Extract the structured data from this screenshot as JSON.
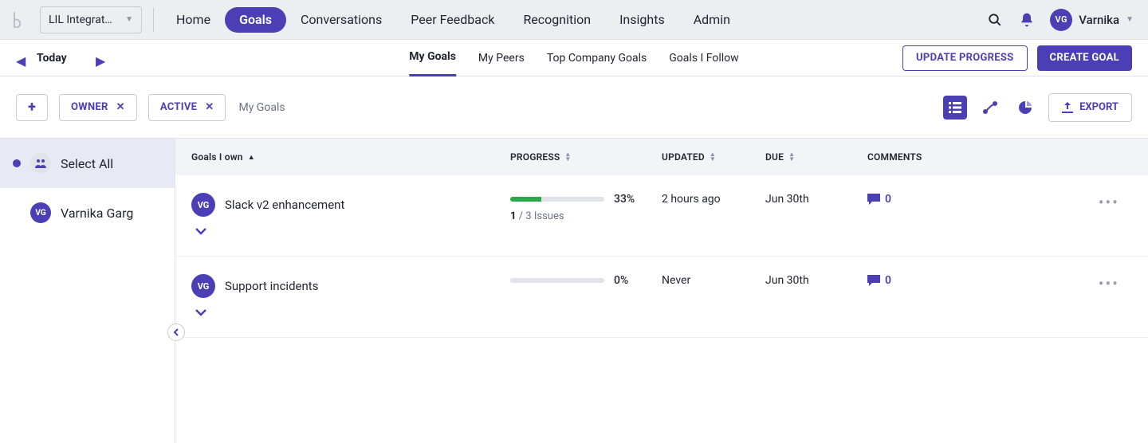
{
  "accent": "#4c3fb5",
  "header": {
    "team_selector": "LIL Integrat…",
    "nav": [
      "Home",
      "Goals",
      "Conversations",
      "Peer Feedback",
      "Recognition",
      "Insights",
      "Admin"
    ],
    "active_nav_index": 1,
    "user": {
      "initials": "VG",
      "name": "Varnika"
    }
  },
  "subnav": {
    "date_label": "Today",
    "tabs": [
      "My Goals",
      "My Peers",
      "Top Company Goals",
      "Goals I Follow"
    ],
    "active_tab_index": 0,
    "update_button": "UPDATE PROGRESS",
    "create_button": "CREATE GOAL"
  },
  "filters": {
    "chips": [
      "OWNER",
      "ACTIVE"
    ],
    "breadcrumb": "My Goals",
    "export_label": "EXPORT"
  },
  "sidebar": {
    "items": [
      {
        "label": "Select All",
        "selected": true,
        "type": "all"
      },
      {
        "label": "Varnika Garg",
        "selected": false,
        "type": "user",
        "initials": "VG"
      }
    ]
  },
  "table": {
    "columns": {
      "title": "Goals I own",
      "progress": "PROGRESS",
      "updated": "UPDATED",
      "due": "DUE",
      "comments": "COMMENTS"
    },
    "issues_word": "Issues",
    "rows": [
      {
        "avatar": "VG",
        "name": "Slack v2 enhancement",
        "progress_pct": 33,
        "progress_label": "33%",
        "issues_done": 1,
        "issues_total": 3,
        "updated": "2 hours ago",
        "due": "Jun 30th",
        "comments": 0
      },
      {
        "avatar": "VG",
        "name": "Support incidents",
        "progress_pct": 0,
        "progress_label": "0%",
        "issues_done": null,
        "issues_total": null,
        "updated": "Never",
        "due": "Jun 30th",
        "comments": 0
      }
    ]
  }
}
